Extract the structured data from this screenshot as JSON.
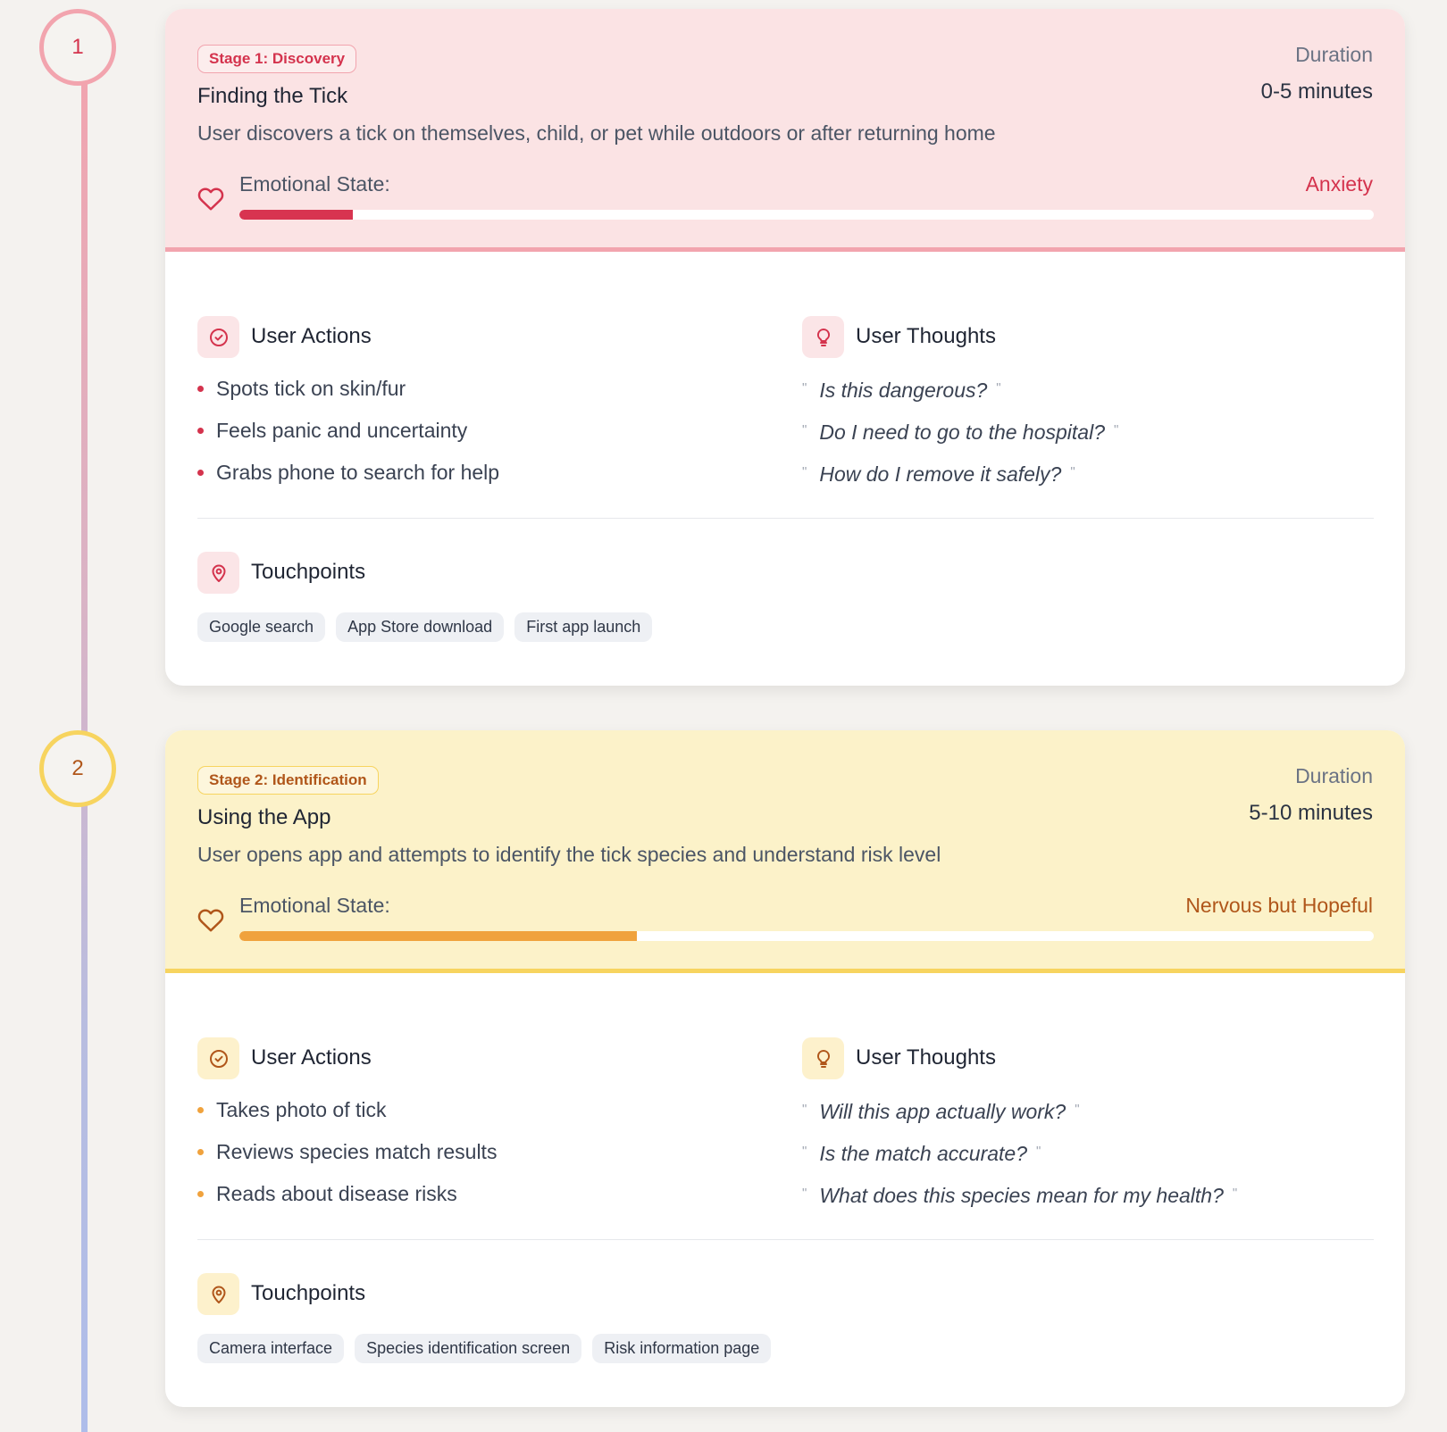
{
  "theme": {
    "stage1": {
      "head_bg": "#fbe3e4",
      "accent": "#d4334d",
      "border": "#f2a4ae",
      "icon_bg": "#fbe5e7",
      "fill": "#d83450"
    },
    "stage2": {
      "head_bg": "#fcf2c9",
      "accent": "#b0561a",
      "border": "#f7d45f",
      "icon_bg": "#fdf1cc",
      "fill": "#f0a23d"
    }
  },
  "stages": [
    {
      "number": "1",
      "badge": "Stage 1: Discovery",
      "title": "Finding the Tick",
      "description": "User discovers a tick on themselves, child, or pet while outdoors or after returning home",
      "duration_label": "Duration",
      "duration_value": "0-5 minutes",
      "emotional_label": "Emotional State:",
      "emotional_value": "Anxiety",
      "emotional_level": 0.1,
      "actions_title": "User Actions",
      "actions": [
        "Spots tick on skin/fur",
        "Feels panic and uncertainty",
        "Grabs phone to search for help"
      ],
      "thoughts_title": "User Thoughts",
      "thoughts": [
        "Is this dangerous?",
        "Do I need to go to the hospital?",
        "How do I remove it safely?"
      ],
      "touchpoints_title": "Touchpoints",
      "touchpoints": [
        "Google search",
        "App Store download",
        "First app launch"
      ]
    },
    {
      "number": "2",
      "badge": "Stage 2: Identification",
      "title": "Using the App",
      "description": "User opens app and attempts to identify the tick species and understand risk level",
      "duration_label": "Duration",
      "duration_value": "5-10 minutes",
      "emotional_label": "Emotional State:",
      "emotional_value": "Nervous but Hopeful",
      "emotional_level": 0.35,
      "actions_title": "User Actions",
      "actions": [
        "Takes photo of tick",
        "Reviews species match results",
        "Reads about disease risks"
      ],
      "thoughts_title": "User Thoughts",
      "thoughts": [
        "Will this app actually work?",
        "Is the match accurate?",
        "What does this species mean for my health?"
      ],
      "touchpoints_title": "Touchpoints",
      "touchpoints": [
        "Camera interface",
        "Species identification screen",
        "Risk information page"
      ]
    }
  ]
}
